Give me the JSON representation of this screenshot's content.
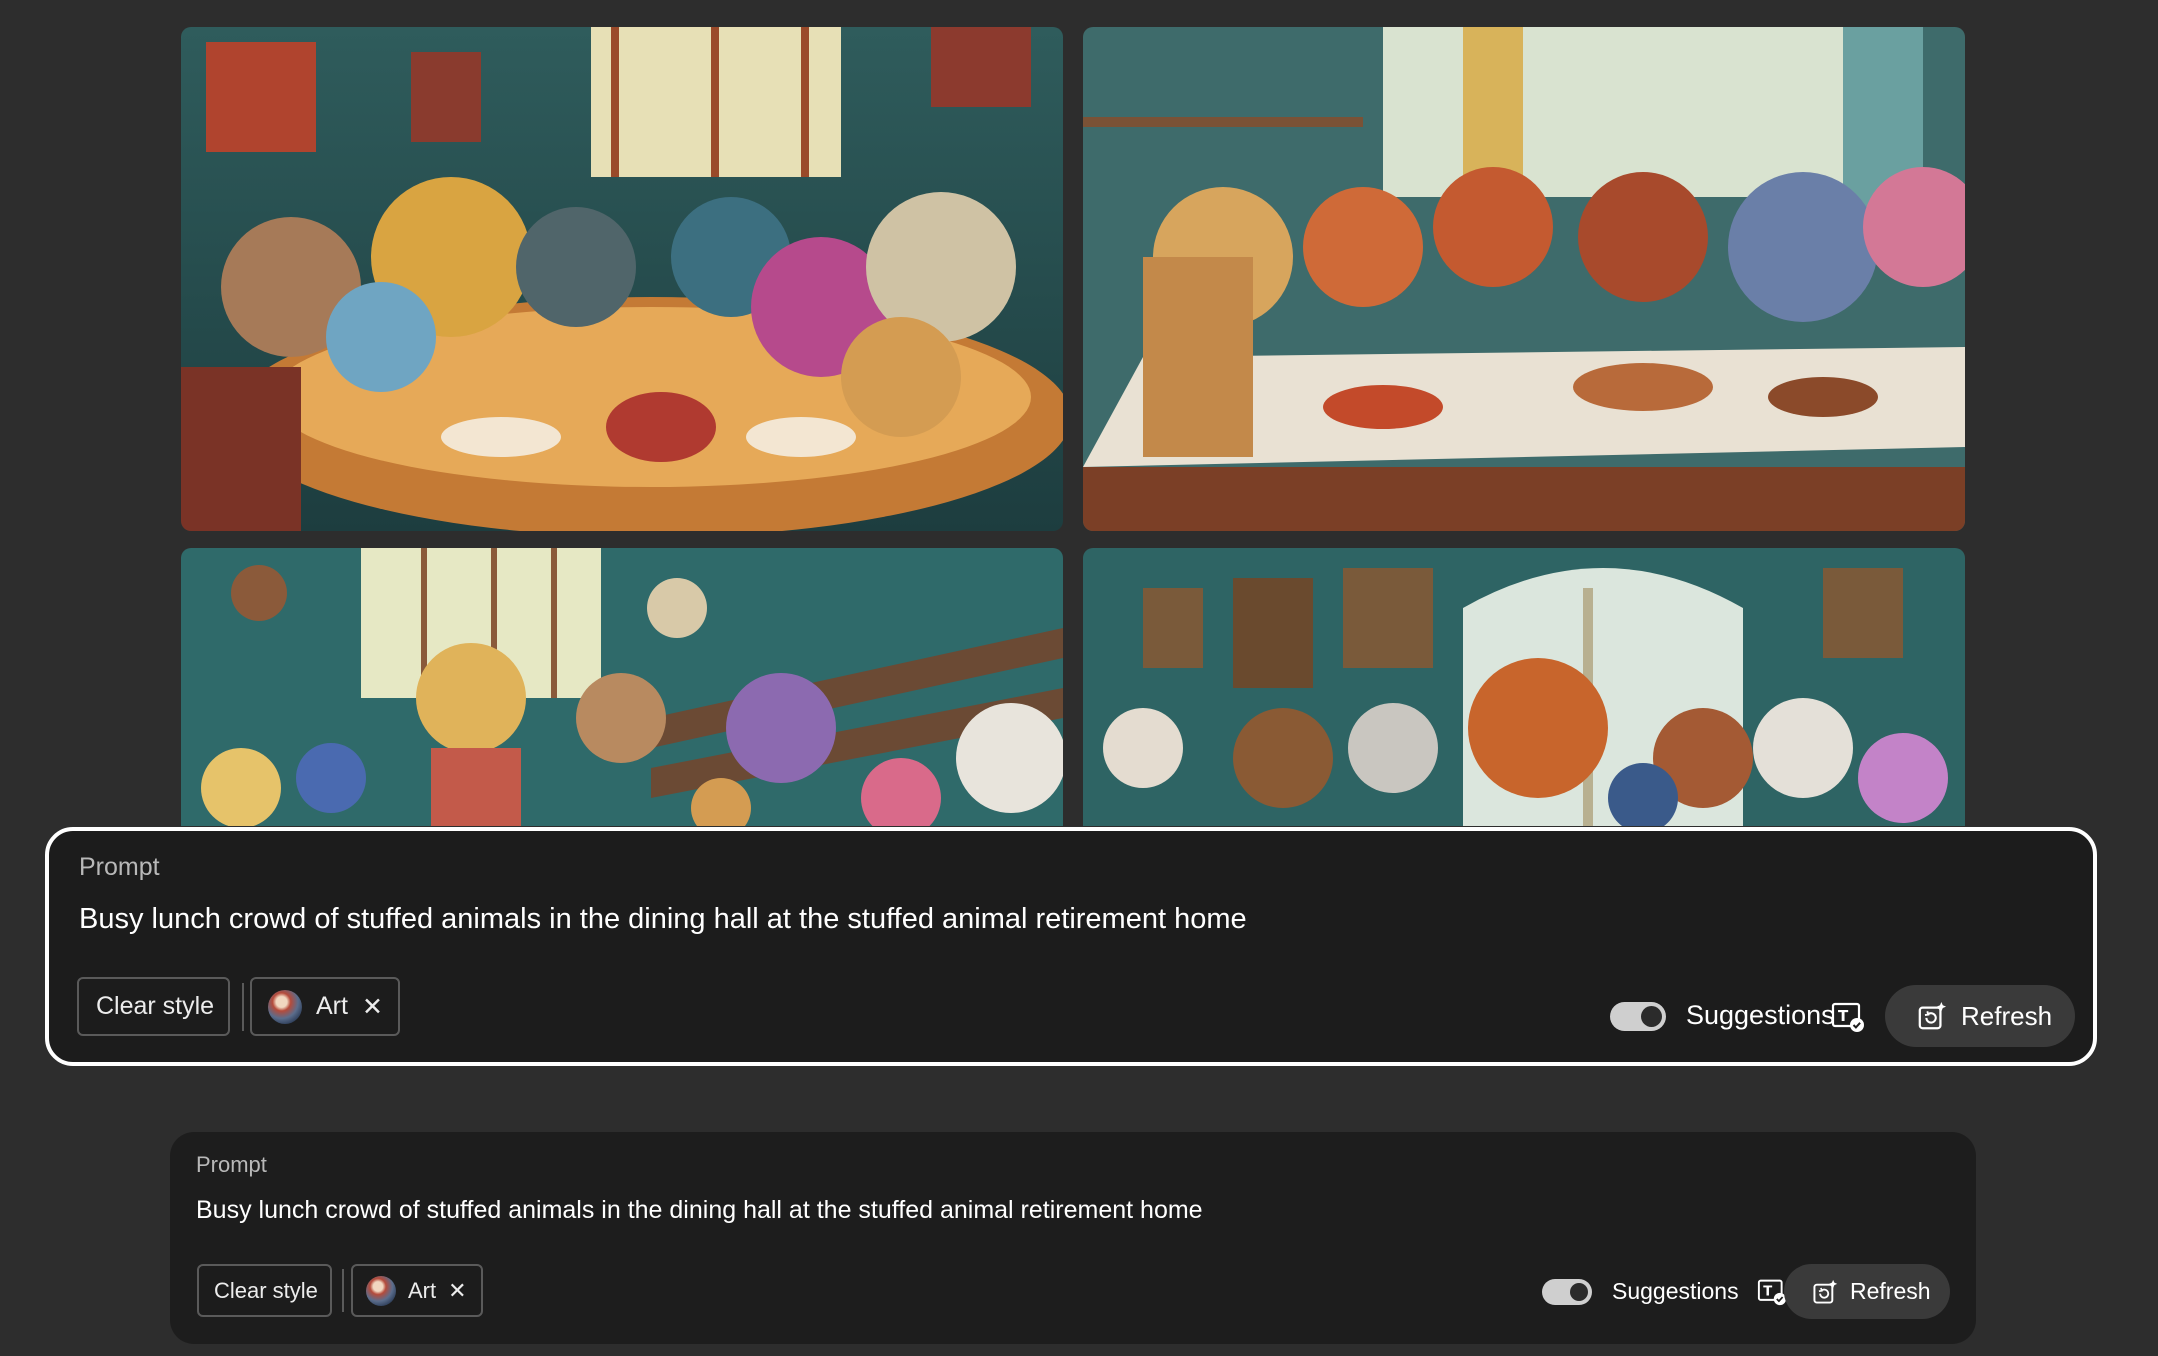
{
  "images": [
    {
      "alt": "generated-image-1"
    },
    {
      "alt": "generated-image-2"
    },
    {
      "alt": "generated-image-3"
    },
    {
      "alt": "generated-image-4"
    }
  ],
  "prompt_panel_large": {
    "label": "Prompt",
    "text": "Busy lunch crowd of stuffed animals in the dining hall at the stuffed animal retirement home",
    "clear_style": "Clear style",
    "style_chip": "Art",
    "remove_glyph": "✕",
    "suggestions_label": "Suggestions",
    "suggestions_on": true,
    "refresh_label": "Refresh"
  },
  "prompt_panel_small": {
    "label": "Prompt",
    "text": "Busy lunch crowd of stuffed animals in the dining hall at the stuffed animal retirement home",
    "clear_style": "Clear style",
    "style_chip": "Art",
    "remove_glyph": "✕",
    "suggestions_label": "Suggestions",
    "suggestions_on": true,
    "refresh_label": "Refresh"
  },
  "colors": {
    "page_bg": "#2d2d2d",
    "panel_bg": "#1c1c1c",
    "focus_border": "#ffffff",
    "toggle_on": "#cfcfcf",
    "refresh_bg": "#3a3a3a"
  },
  "icons": {
    "remove": "close-icon",
    "suggestions": "text-suggestions-icon",
    "refresh": "refresh-sparkle-icon"
  }
}
